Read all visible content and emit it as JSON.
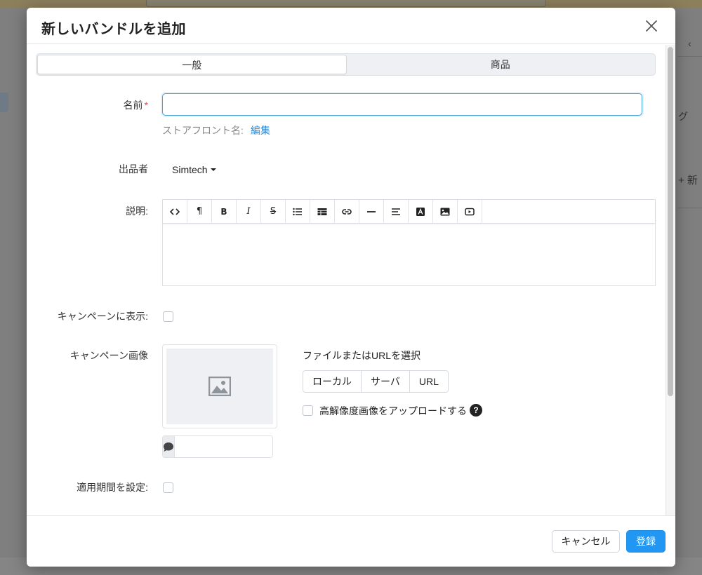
{
  "dialog": {
    "title": "新しいバンドルを追加"
  },
  "tabs": [
    {
      "label": "一般",
      "active": true
    },
    {
      "label": "商品",
      "active": false
    }
  ],
  "form": {
    "name_label": "名前",
    "name_required_mark": "*",
    "name_value": "",
    "storefront_label": "ストアフロント名:",
    "storefront_edit": "編集",
    "vendor_label": "出品者",
    "vendor_value": "Simtech",
    "description_label": "説明:",
    "show_in_campaign_label": "キャンペーンに表示:",
    "campaign_image_label": "キャンペーン画像",
    "file_select_title": "ファイルまたはURLを選択",
    "source_buttons": [
      "ローカル",
      "サーバ",
      "URL"
    ],
    "hires_label": "高解像度画像をアップロードする",
    "help_glyph": "?",
    "set_period_label": "適用期間を設定:"
  },
  "toolbar_icons": [
    "code-view-icon",
    "paragraph-icon",
    "bold-icon",
    "italic-icon",
    "strikethrough-icon",
    "bulleted-list-icon",
    "table-icon",
    "link-icon",
    "horizontal-rule-icon",
    "align-icon",
    "font-color-icon",
    "image-icon",
    "video-icon"
  ],
  "footer": {
    "cancel_label": "キャンセル",
    "submit_label": "登録"
  },
  "background": {
    "right_text_fragment": "グ",
    "right_add_fragment": "+ 新"
  },
  "colors": {
    "primary": "#2196f3",
    "link": "#2b87d0",
    "required": "#e5484d",
    "focus_border": "#4a9fd8"
  }
}
